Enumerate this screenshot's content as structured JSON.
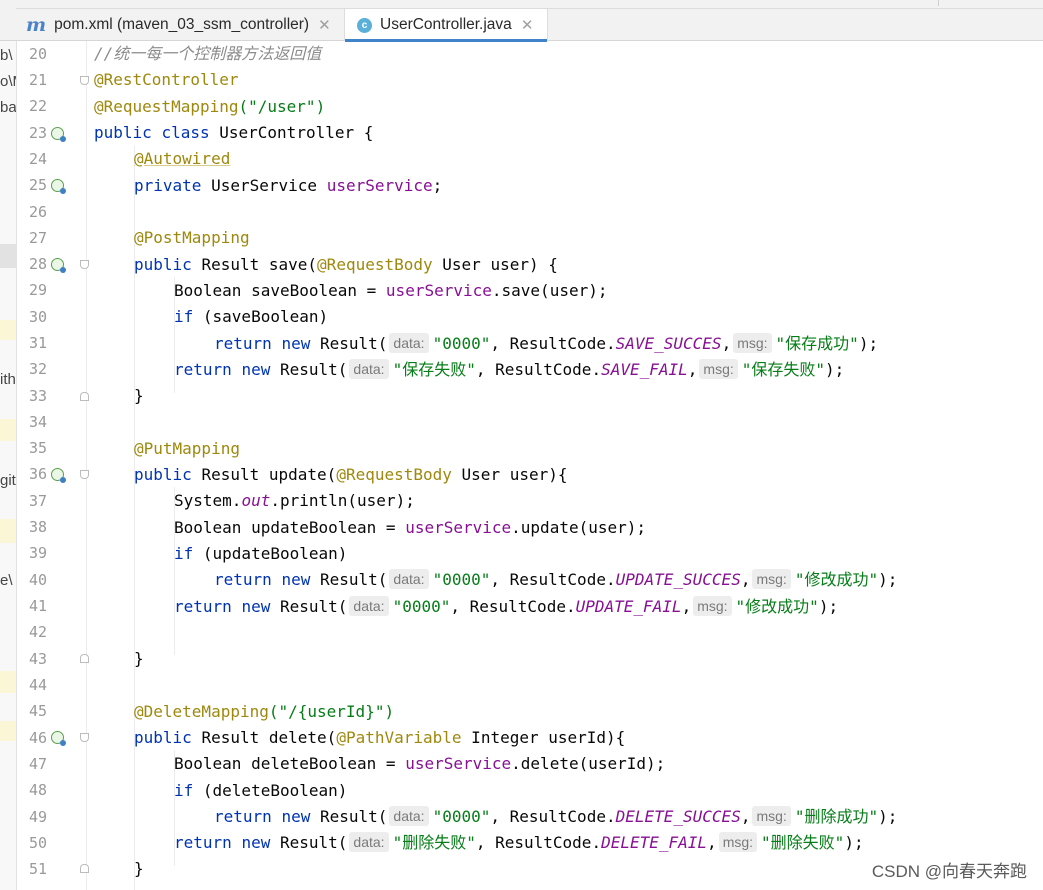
{
  "tabs": [
    {
      "label": "pom.xml (maven_03_ssm_controller)",
      "icon": "maven-icon",
      "active": false
    },
    {
      "label": "UserController.java",
      "icon": "class-icon",
      "active": true
    }
  ],
  "project_fragments": [
    "b\\",
    "o\\M",
    "ba",
    "ith",
    "git",
    "e\\"
  ],
  "gutter": {
    "line_numbers": [
      "20",
      "21",
      "22",
      "23",
      "24",
      "25",
      "26",
      "27",
      "28",
      "29",
      "30",
      "31",
      "32",
      "33",
      "34",
      "35",
      "36",
      "37",
      "38",
      "39",
      "40",
      "41",
      "42",
      "43",
      "44",
      "45",
      "46",
      "47",
      "48",
      "49",
      "50",
      "51"
    ]
  },
  "code": {
    "comment": "//统一每一个控制器方法返回值",
    "ann_rest": "@RestController",
    "ann_mapping": "@RequestMapping",
    "mapping_path": "(\"/user\")",
    "kw_public": "public",
    "kw_class": "class",
    "class_name": "UserController",
    "brace_open": " {",
    "brace_close": "}",
    "ann_autowired": "@Autowired",
    "kw_private": "private",
    "type_userservice": "UserService",
    "field_userservice": "userService",
    "semicolon": ";",
    "ann_post": "@PostMapping",
    "ann_put": "@PutMapping",
    "ann_delete": "@DeleteMapping",
    "delete_path": "(\"/{userId}\")",
    "type_result": "Result",
    "ann_requestbody": "@RequestBody",
    "ann_pathvariable": "@PathVariable",
    "kw_if": "if",
    "kw_return": "return",
    "kw_new": "new",
    "result_call": "Result(",
    "hint_data": "data:",
    "hint_msg": "msg:",
    "resultcode": "ResultCode.",
    "save_sig": "save(",
    "save_params": " User user) {",
    "save_decl": "Boolean saveBoolean = ",
    "save_call": ".save(user);",
    "save_if": " (saveBoolean)",
    "update_sig": "update(",
    "update_params": " User user){",
    "sysout_pre": "System.",
    "sysout_out": "out",
    "sysout_post": ".println(user);",
    "update_decl": "Boolean updateBoolean = ",
    "update_call": ".update(user);",
    "update_if": " (updateBoolean)",
    "delete_sig": "delete(",
    "delete_params": " Integer userId){",
    "delete_decl": "Boolean deleteBoolean = ",
    "delete_call": ".delete(userId);",
    "delete_if": " (deleteBoolean)",
    "s0000": "\"0000\"",
    "comma": ", ",
    "comma_nospace": ",",
    "close_paren": ");",
    "c_save_succes": "SAVE_SUCCES",
    "c_save_fail": "SAVE_FAIL",
    "c_update_succes": "UPDATE_SUCCES",
    "c_update_fail": "UPDATE_FAIL",
    "c_delete_succes": "DELETE_SUCCES",
    "c_delete_fail": "DELETE_FAIL",
    "s_save_ok": "\"保存成功\"",
    "s_save_fail": "\"保存失败\"",
    "s_update_ok": "\"修改成功\"",
    "s_delete_ok": "\"删除成功\"",
    "s_delete_fail": "\"删除失败\""
  },
  "watermark": "CSDN @向春天奔跑",
  "colors": {
    "keyword": "#0033b3",
    "annotation": "#9e880d",
    "field": "#871094",
    "string": "#067d17",
    "comment": "#8c8c8c",
    "tab_accent": "#4083c9"
  }
}
